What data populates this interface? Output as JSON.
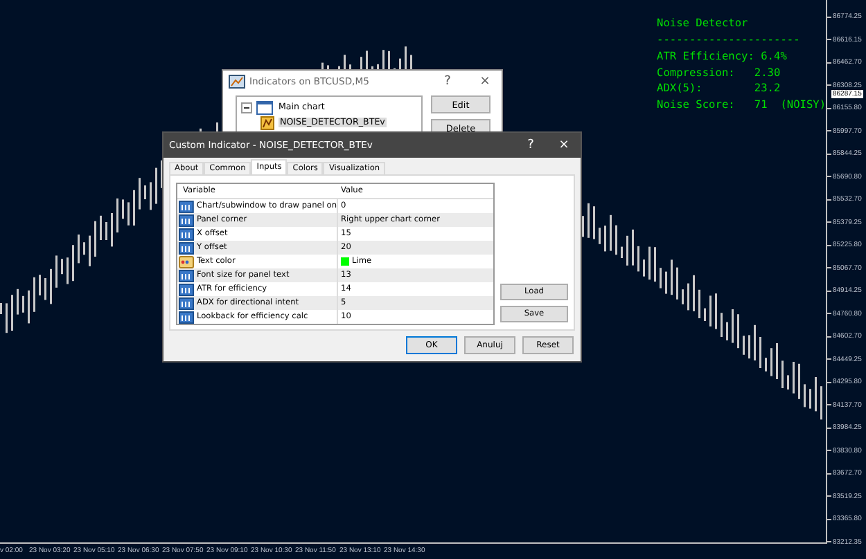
{
  "chart": {
    "price_labels": [
      "86774.25",
      "86616.15",
      "86462.70",
      "86308.25",
      "86155.80",
      "85997.70",
      "85844.25",
      "85690.80",
      "85532.70",
      "85379.25",
      "85225.80",
      "85067.70",
      "84914.25",
      "84760.80",
      "84602.70",
      "84449.25",
      "84295.80",
      "84137.70",
      "83984.25",
      "83830.80",
      "83672.70",
      "83519.25",
      "83365.80",
      "83212.35"
    ],
    "current_price": "86287.15",
    "time_labels": [
      "v 02:00",
      "23 Nov 03:20",
      "23 Nov 05:10",
      "23 Nov 06:30",
      "23 Nov 07:50",
      "23 Nov 09:10",
      "23 Nov 10:30",
      "23 Nov 11:50",
      "23 Nov 13:10",
      "23 Nov 14:30"
    ],
    "panel": [
      "Noise Detector",
      "----------------------",
      "ATR Efficiency: 6.4%",
      "Compression:   2.30",
      "ADX(5):        23.2",
      "Noise Score:   71  (NOISY)"
    ]
  },
  "indicators_window": {
    "title": "Indicators on BTCUSD,M5",
    "help": "?",
    "close": "×",
    "tree": [
      {
        "label": "Main chart",
        "expanded": true,
        "children": [
          {
            "label": "NOISE_DETECTOR_BTEv",
            "selected": true
          }
        ]
      }
    ],
    "buttons": [
      "Edit",
      "Delete"
    ]
  },
  "dialog": {
    "title": "Custom Indicator - NOISE_DETECTOR_BTEv",
    "help": "?",
    "close": "×",
    "tabs": [
      {
        "label": "About",
        "selected": false
      },
      {
        "label": "Common",
        "selected": false
      },
      {
        "label": "Inputs",
        "selected": true
      },
      {
        "label": "Colors",
        "selected": false
      },
      {
        "label": "Visualization",
        "selected": false
      }
    ],
    "table": {
      "columns": [
        "Variable",
        "Value"
      ],
      "rows": [
        {
          "kind": "number",
          "variable": "Chart/subwindow to draw panel on",
          "value": "0"
        },
        {
          "kind": "number",
          "variable": "Panel corner",
          "value": "Right upper chart corner"
        },
        {
          "kind": "number",
          "variable": "X offset",
          "value": "15"
        },
        {
          "kind": "number",
          "variable": "Y offset",
          "value": "20"
        },
        {
          "kind": "color",
          "variable": "Text color",
          "value": "Lime",
          "color": "#00ff00"
        },
        {
          "kind": "number",
          "variable": "Font size for panel text",
          "value": "13"
        },
        {
          "kind": "number",
          "variable": "ATR for efficiency",
          "value": "14"
        },
        {
          "kind": "number",
          "variable": "ADX for directional intent",
          "value": "5"
        },
        {
          "kind": "number",
          "variable": "Lookback for efficiency calc",
          "value": "10"
        }
      ]
    },
    "side_buttons": [
      "Load",
      "Save"
    ],
    "buttons": [
      {
        "label": "OK",
        "default": true
      },
      {
        "label": "Anuluj",
        "default": false
      },
      {
        "label": "Reset",
        "default": false
      }
    ]
  }
}
